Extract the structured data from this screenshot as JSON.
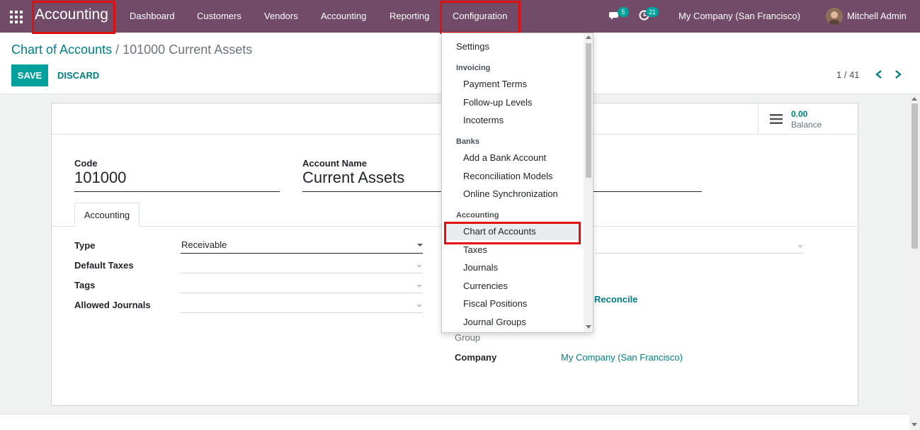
{
  "navbar": {
    "brand": "Accounting",
    "menu": [
      "Dashboard",
      "Customers",
      "Vendors",
      "Accounting",
      "Reporting",
      "Configuration"
    ],
    "messages_count": "5",
    "activities_count": "21",
    "company": "My Company (San Francisco)",
    "user": "Mitchell Admin"
  },
  "breadcrumb": {
    "parent": "Chart of Accounts",
    "separator": "/",
    "current": "101000 Current Assets"
  },
  "actions": {
    "save": "SAVE",
    "discard": "DISCARD"
  },
  "pager": {
    "value": "1 / 41"
  },
  "stat": {
    "value": "0.00",
    "label": "Balance"
  },
  "form": {
    "code_label": "Code",
    "code_value": "101000",
    "name_label": "Account Name",
    "name_value": "Current Assets",
    "tab": "Accounting",
    "type_label": "Type",
    "type_value": "Receivable",
    "taxes_label": "Default Taxes",
    "tags_label": "Tags",
    "journals_label": "Allowed Journals",
    "reconcile_label": "Reconcile",
    "group_label": "Group",
    "company_label": "Company",
    "company_value": "My Company (San Francisco)"
  },
  "dropdown": {
    "top_item": "Settings",
    "sections": [
      {
        "header": "Invoicing",
        "items": [
          "Payment Terms",
          "Follow-up Levels",
          "Incoterms"
        ]
      },
      {
        "header": "Banks",
        "items": [
          "Add a Bank Account",
          "Reconciliation Models",
          "Online Synchronization"
        ]
      },
      {
        "header": "Accounting",
        "items": [
          "Chart of Accounts",
          "Taxes",
          "Journals",
          "Currencies",
          "Fiscal Positions",
          "Journal Groups"
        ]
      }
    ],
    "active_item": "Chart of Accounts"
  },
  "colors": {
    "navbar": "#714B67",
    "accent": "#00A09D",
    "link": "#017e84",
    "highlight": "#e01010"
  }
}
